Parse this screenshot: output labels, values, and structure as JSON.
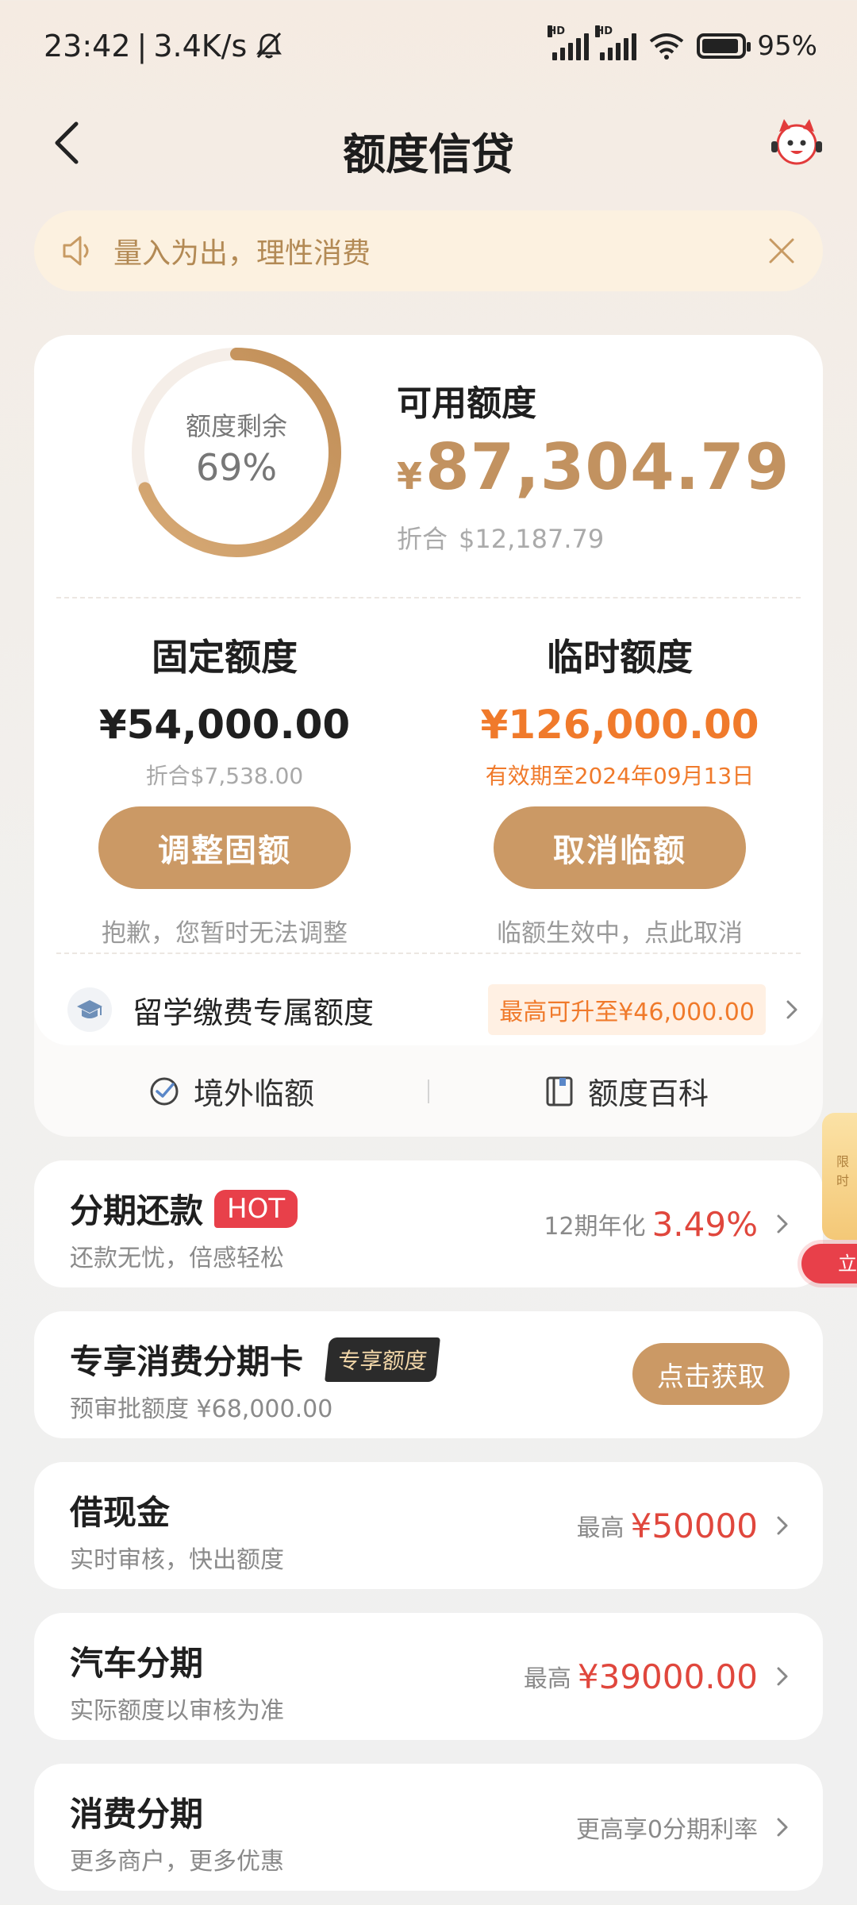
{
  "status_bar": {
    "time": "23:42",
    "net_speed": "3.4K/s",
    "signal_tag": "HD",
    "battery": "95%"
  },
  "header": {
    "title": "额度信贷"
  },
  "notice": {
    "text": "量入为出，理性消费"
  },
  "credit": {
    "ring_label": "额度剩余",
    "ring_percent": "69%",
    "ring_fraction": 0.69,
    "available_label": "可用额度",
    "currency_symbol": "¥",
    "available_amount": "87,304.79",
    "usd_prefix": "折合",
    "usd_amount": "$12,187.79",
    "fixed": {
      "title": "固定额度",
      "amount": "¥54,000.00",
      "sub": "折合$7,538.00",
      "button": "调整固额",
      "note": "抱歉，您暂时无法调整"
    },
    "temporary": {
      "title": "临时额度",
      "amount": "¥126,000.00",
      "sub": "有效期至2024年09月13日",
      "button": "取消临额",
      "note": "临额生效中，点此取消"
    },
    "study": {
      "label": "留学缴费专属额度",
      "badge": "最高可升至¥46,000.00"
    },
    "links": {
      "overseas": "境外临额",
      "encyclopedia": "额度百科"
    }
  },
  "products": [
    {
      "title": "分期还款",
      "badge": "HOT",
      "sub": "还款无忧，倍感轻松",
      "right_muted": "12期年化",
      "right_value": "3.49%"
    },
    {
      "title": "专享消费分期卡",
      "badge": "专享额度",
      "sub": "预审批额度 ¥68,000.00",
      "button": "点击获取"
    },
    {
      "title": "借现金",
      "sub": "实时审核，快出额度",
      "right_muted": "最高",
      "right_value": "¥50000"
    },
    {
      "title": "汽车分期",
      "sub": "实际额度以审核为准",
      "right_muted": "最高",
      "right_value": "¥39000.00"
    },
    {
      "title": "消费分期",
      "sub": "更多商户，更多优惠",
      "right_muted": "更高享0分期利率"
    }
  ],
  "float_promo": {
    "tag": "限时",
    "button": "立"
  },
  "colors": {
    "accent": "#cb9965",
    "amount_gold": "#c29260",
    "orange": "#f07a2b",
    "red": "#e0473d"
  }
}
